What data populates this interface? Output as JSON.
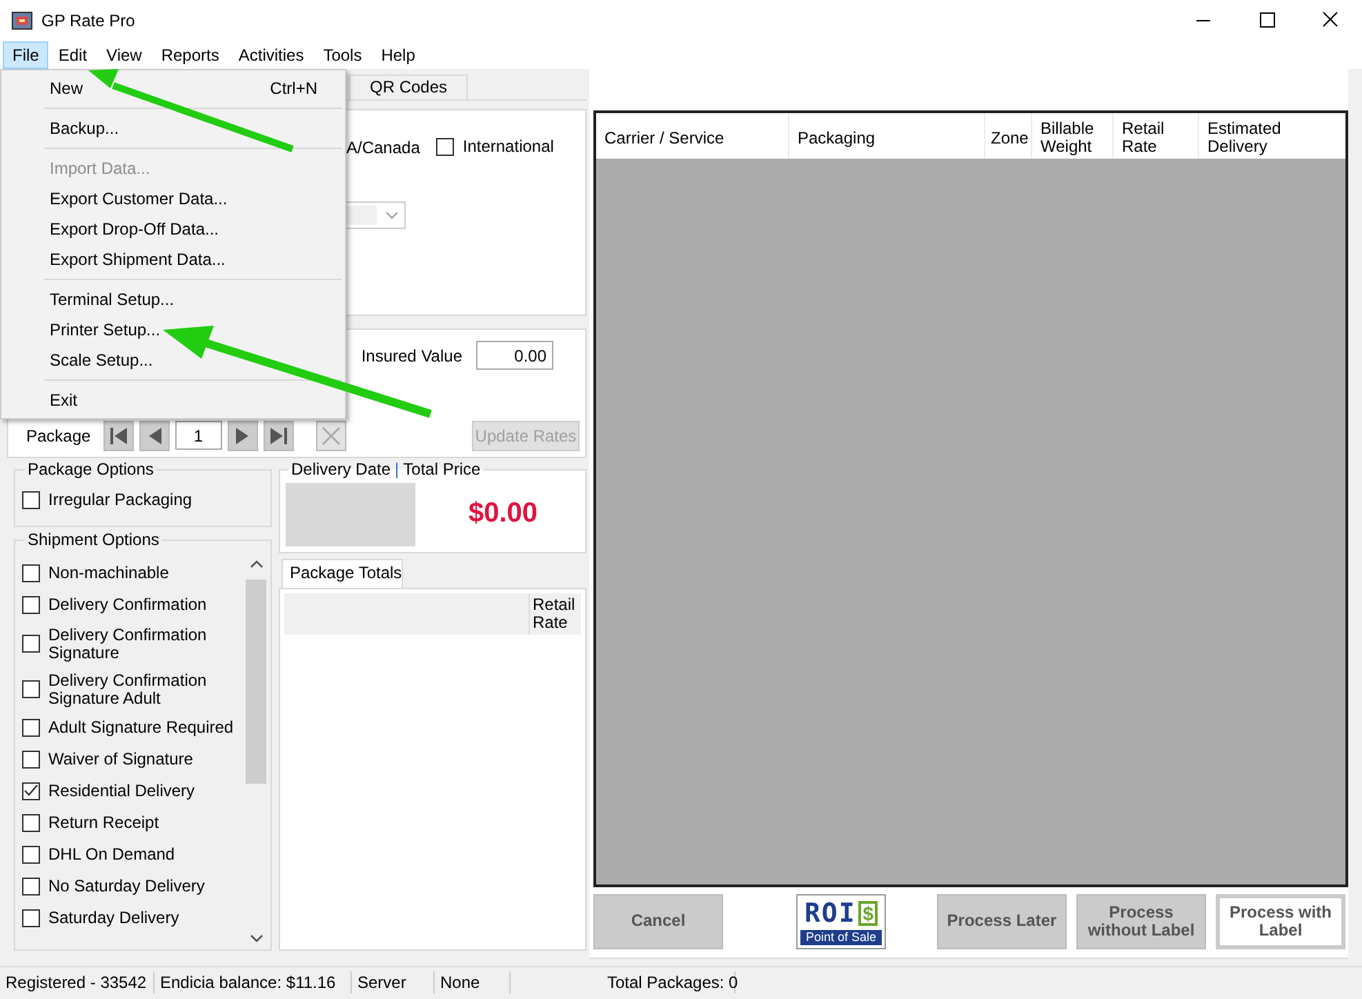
{
  "window": {
    "title": "GP Rate Pro"
  },
  "menu_bar": [
    {
      "label": "File",
      "selected": true
    },
    {
      "label": "Edit",
      "selected": false
    },
    {
      "label": "View",
      "selected": false
    },
    {
      "label": "Reports",
      "selected": false
    },
    {
      "label": "Activities",
      "selected": false
    },
    {
      "label": "Tools",
      "selected": false
    },
    {
      "label": "Help",
      "selected": false
    }
  ],
  "file_menu": {
    "items": [
      {
        "kind": "item",
        "label": "New",
        "shortcut": "Ctrl+N",
        "disabled": false
      },
      {
        "kind": "separator"
      },
      {
        "kind": "item",
        "label": "Backup...",
        "disabled": false
      },
      {
        "kind": "separator"
      },
      {
        "kind": "item",
        "label": "Import Data...",
        "disabled": true
      },
      {
        "kind": "item",
        "label": "Export Customer Data...",
        "disabled": false
      },
      {
        "kind": "item",
        "label": "Export Drop-Off Data...",
        "disabled": false
      },
      {
        "kind": "item",
        "label": "Export Shipment Data...",
        "disabled": false
      },
      {
        "kind": "separator"
      },
      {
        "kind": "item",
        "label": "Terminal Setup...",
        "disabled": false
      },
      {
        "kind": "item",
        "label": "Printer Setup...",
        "disabled": false
      },
      {
        "kind": "item",
        "label": "Scale Setup...",
        "disabled": false
      },
      {
        "kind": "separator"
      },
      {
        "kind": "item",
        "label": "Exit",
        "disabled": false
      }
    ]
  },
  "tabs": [
    {
      "label": "QR Codes",
      "selected": false
    }
  ],
  "destination": {
    "partial_label": "A/Canada",
    "international": {
      "label": "International",
      "checked": false
    }
  },
  "insured_value": {
    "label": "Insured Value",
    "value": "0.00"
  },
  "package_nav": {
    "label": "Package",
    "value": "1"
  },
  "update_rates": {
    "label": "Update Rates",
    "disabled": true
  },
  "package_options": {
    "title": "Package Options",
    "items": [
      {
        "label": "Irregular Packaging",
        "checked": false
      }
    ]
  },
  "shipment_options": {
    "title": "Shipment Options",
    "items": [
      {
        "label": "Non-machinable",
        "checked": false
      },
      {
        "label": "Delivery Confirmation",
        "checked": false
      },
      {
        "label": "Delivery Confirmation Signature",
        "checked": false
      },
      {
        "label": "Delivery Confirmation Signature Adult",
        "checked": false
      },
      {
        "label": "Adult Signature Required",
        "checked": false
      },
      {
        "label": "Waiver of Signature",
        "checked": false
      },
      {
        "label": "Residential Delivery",
        "checked": true
      },
      {
        "label": "Return Receipt",
        "checked": false
      },
      {
        "label": "DHL On Demand",
        "checked": false
      },
      {
        "label": "No Saturday Delivery",
        "checked": false
      },
      {
        "label": "Saturday Delivery",
        "checked": false
      }
    ]
  },
  "delivery": {
    "title_left": "Delivery Date",
    "separator": "|",
    "title_right": "Total Price",
    "total": "$0.00"
  },
  "package_totals": {
    "tab": {
      "label": "Package Totals",
      "selected": true
    },
    "columns": [
      "Retail Rate"
    ]
  },
  "rates_table": {
    "columns": [
      "Carrier / Service",
      "Packaging",
      "Zone",
      "Billable Weight",
      "Retail Rate",
      "Estimated Delivery"
    ]
  },
  "actions": [
    {
      "kind": "button",
      "label": "Cancel",
      "primary": false
    },
    {
      "kind": "logo",
      "mark": "ROI",
      "symbol": "$",
      "caption": "Point of Sale"
    },
    {
      "kind": "button",
      "label": "Process Later",
      "primary": false
    },
    {
      "kind": "button",
      "label": "Process without Label",
      "primary": false
    },
    {
      "kind": "button",
      "label": "Process with Label",
      "primary": true
    }
  ],
  "status_bar": [
    "Registered - 33542",
    "Endicia balance: $11.16",
    "Server",
    "None",
    "Total Packages: 0"
  ]
}
